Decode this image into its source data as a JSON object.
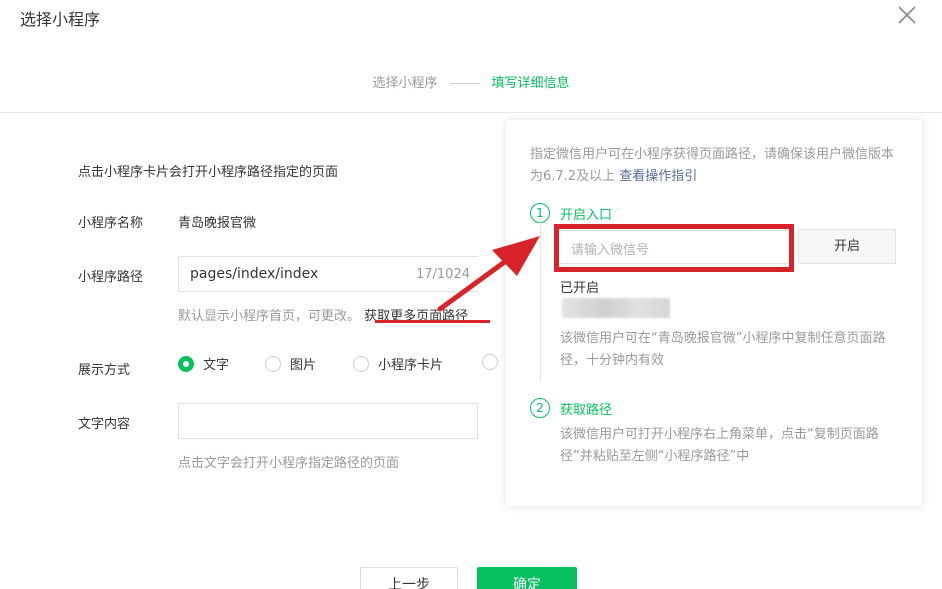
{
  "dialog": {
    "title": "选择小程序"
  },
  "steps": {
    "step1": "选择小程序",
    "step2": "填写详细信息"
  },
  "form": {
    "intro": "点击小程序卡片会打开小程序路径指定的页面",
    "name_label": "小程序名称",
    "name_value": "青岛晚报官微",
    "path_label": "小程序路径",
    "path_value": "pages/index/index",
    "path_counter": "17/1024",
    "path_hint": "默认显示小程序首页，可更改。",
    "path_more_link": "获取更多页面路径",
    "display_label": "展示方式",
    "display_options": [
      "文字",
      "图片",
      "小程序卡片"
    ],
    "display_selected": "文字",
    "text_label": "文字内容",
    "text_value": "",
    "text_hint": "点击文字会打开小程序指定路径的页面"
  },
  "panel": {
    "desc": "指定微信用户可在小程序获得页面路径，请确保该用户微信版本为6.7.2及以上",
    "guide_link": "查看操作指引",
    "step1_num": "1",
    "step1_title": "开启入口",
    "wechat_placeholder": "请输入微信号",
    "open_button": "开启",
    "enabled_label": "已开启",
    "step1_note": "该微信用户可在“青岛晚报官微”小程序中复制任意页面路径，十分钟内有效",
    "step2_num": "2",
    "step2_title": "获取路径",
    "step2_note": "该微信用户可打开小程序右上角菜单，点击“复制页面路径”并粘贴至左侧“小程序路径”中"
  },
  "footer": {
    "prev": "上一步",
    "confirm": "确定"
  },
  "colors": {
    "accent": "#07c160",
    "annotation": "#d9232a",
    "link": "#576b95"
  },
  "icons": {
    "close": "close-icon",
    "radio": "radio-icon",
    "arrow": "annotation-arrow"
  }
}
